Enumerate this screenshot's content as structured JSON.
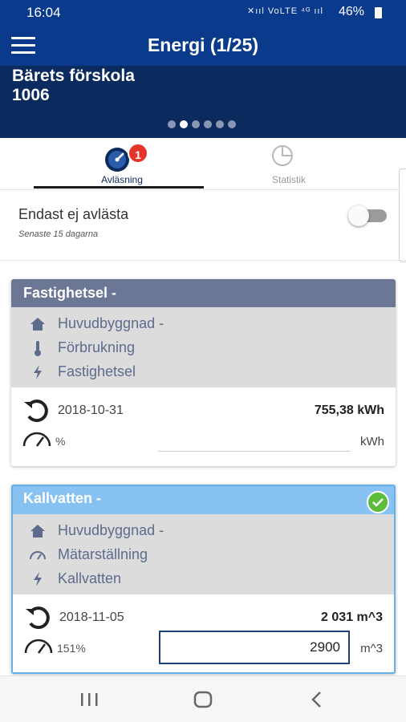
{
  "status_bar": {
    "time": "16:04",
    "signal_icons": "✕ııl  VoLTE  ⁴ᴳ ııl",
    "battery": "46%"
  },
  "app_bar": {
    "title": "Energi (1/25)"
  },
  "header": {
    "name": "Bärets förskola",
    "id": "1006",
    "pager": {
      "pages": 6,
      "active_index": 1
    }
  },
  "tabs": [
    {
      "label": "Avläsning",
      "badge": "1",
      "active": true
    },
    {
      "label": "Statistik",
      "active": false
    }
  ],
  "filter": {
    "title": "Endast ej avlästa",
    "subtitle": "Senaste 15 dagarna",
    "toggle_on": false
  },
  "cards": [
    {
      "title": "Fastighetsel -",
      "info": [
        {
          "icon": "house-icon",
          "text": "Huvudbyggnad -"
        },
        {
          "icon": "thermometer-icon",
          "text": "Förbrukning"
        },
        {
          "icon": "lightning-icon",
          "text": "Fastighetsel"
        }
      ],
      "last_reading": {
        "date": "2018-10-31",
        "value": "755,38 kWh"
      },
      "current": {
        "percent": "%",
        "unit": "kWh",
        "value": ""
      }
    },
    {
      "title": "Kallvatten -",
      "completed": true,
      "info": [
        {
          "icon": "house-icon",
          "text": "Huvudbyggnad -"
        },
        {
          "icon": "gauge-icon",
          "text": "Mätarställning"
        },
        {
          "icon": "lightning-icon",
          "text": "Kallvatten"
        }
      ],
      "last_reading": {
        "date": "2018-11-05",
        "value": "2 031 m^3"
      },
      "current": {
        "percent": "151%",
        "unit": "m^3",
        "value": "2900"
      }
    }
  ],
  "colors": {
    "primary": "#0a3a8c",
    "header_band": "#0b2a5e",
    "card1_header": "#6b7794",
    "card2_header": "#87c2f2",
    "badge": "#e5332a",
    "check": "#5bbd39",
    "info_text": "#5d6b8c"
  }
}
